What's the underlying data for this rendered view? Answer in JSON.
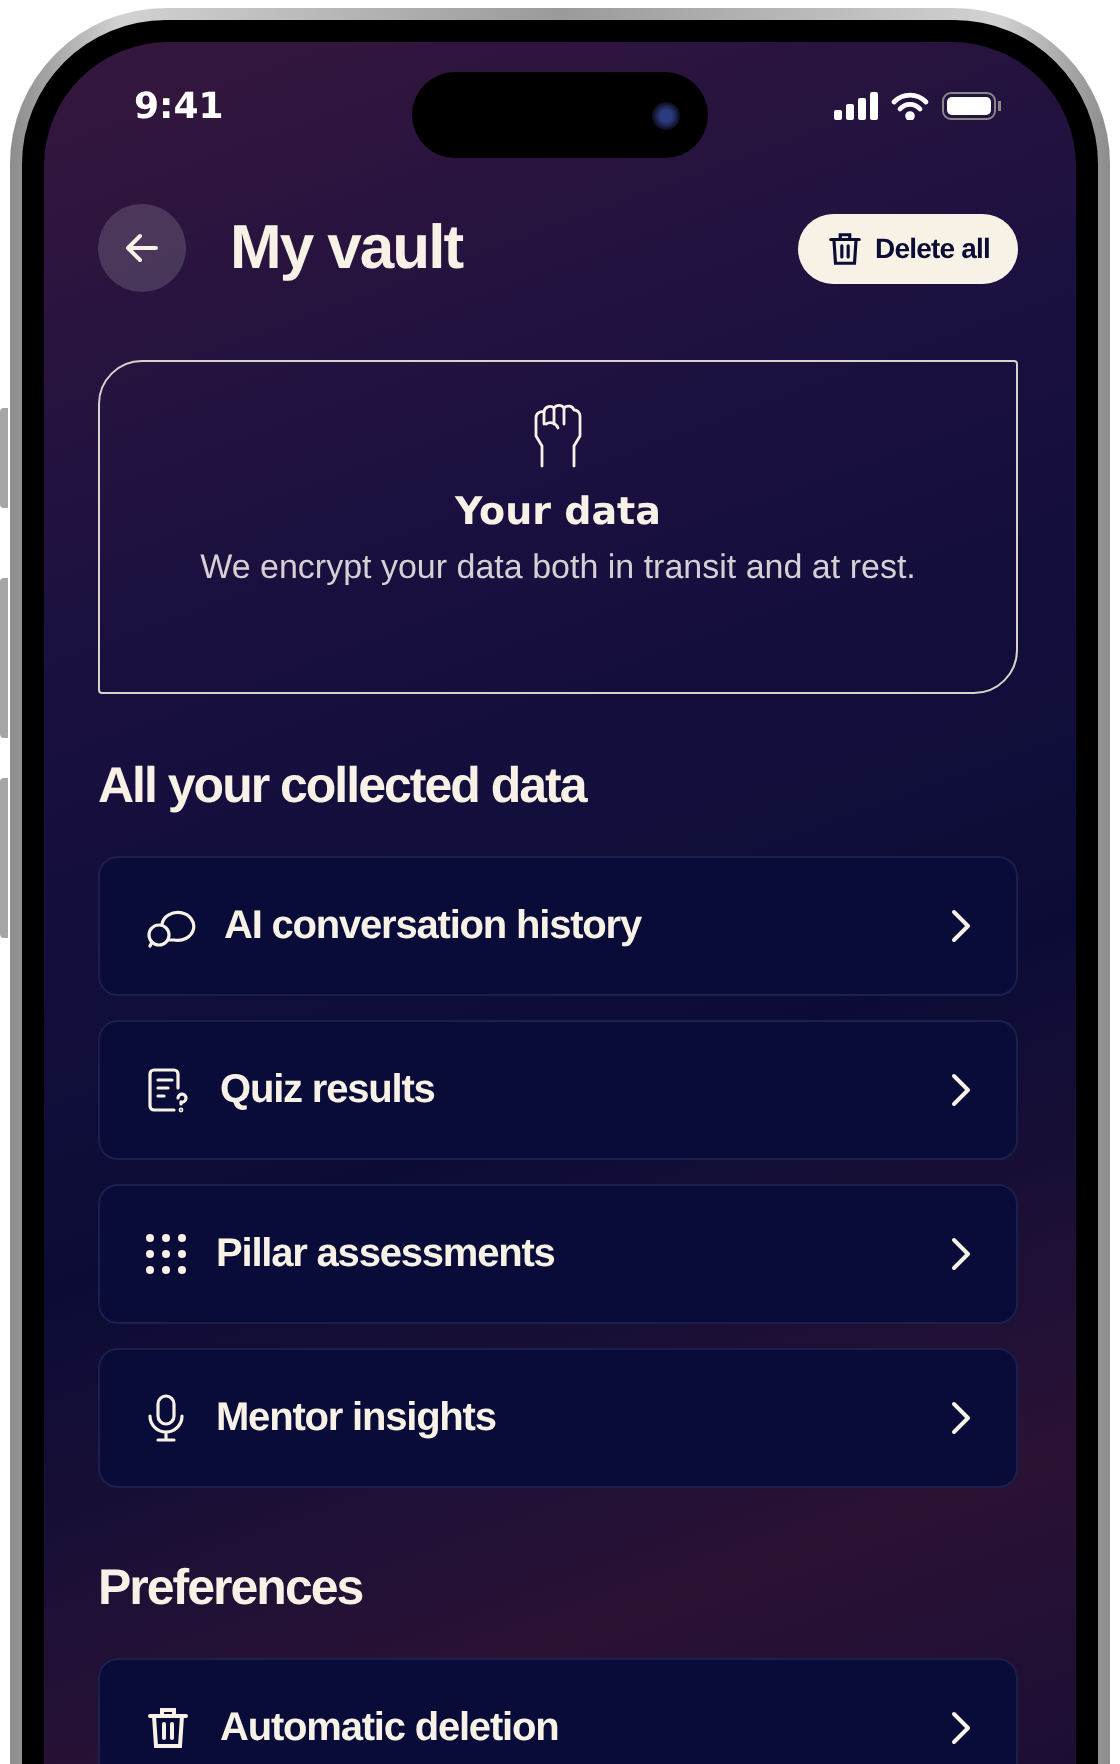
{
  "status_bar": {
    "time": "9:41"
  },
  "header": {
    "title": "My vault",
    "action": "Delete all"
  },
  "info_card": {
    "title": "Your data",
    "text": "We encrypt your data both in transit and at rest."
  },
  "sections": [
    {
      "title": "All your collected data",
      "items": [
        {
          "label": "AI conversation history",
          "kind": "chat"
        },
        {
          "label": "Quiz results",
          "kind": "quiz"
        },
        {
          "label": "Pillar assessments",
          "kind": "dots"
        },
        {
          "label": "Mentor insights",
          "kind": "mic"
        }
      ]
    },
    {
      "title": "Preferences",
      "items": [
        {
          "label": "Automatic deletion",
          "kind": "trash"
        }
      ]
    }
  ]
}
